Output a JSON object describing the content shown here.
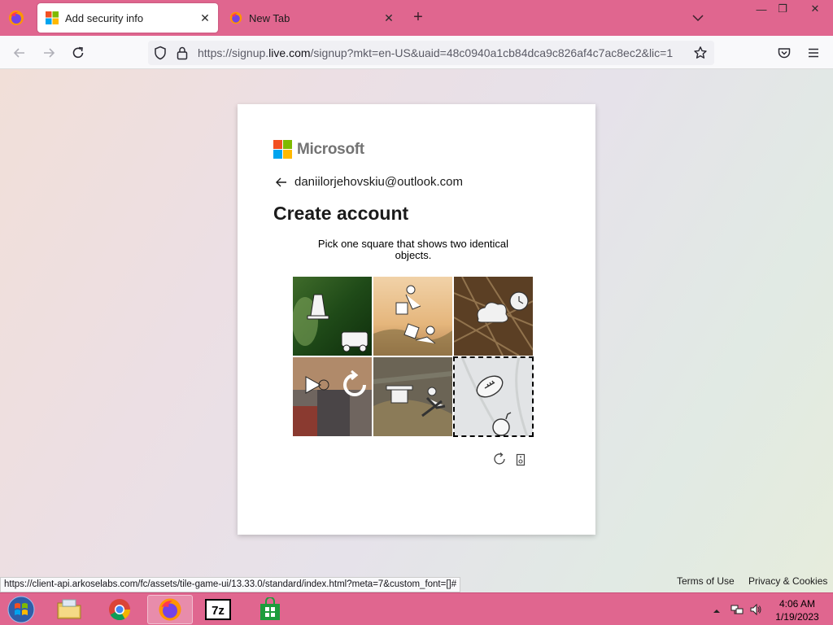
{
  "browser": {
    "tabs": [
      {
        "title": "Add security info",
        "active": true,
        "favicon": "microsoft-logo-icon"
      },
      {
        "title": "New Tab",
        "active": false,
        "favicon": "firefox-icon"
      }
    ],
    "new_tab_label": "+",
    "url_prefix": "https://signup.",
    "url_domain": "live.com",
    "url_rest": "/signup?mkt=en-US&uaid=48c0940a1cb84dca9c826af4c7ac8ec2&lic=1",
    "status_url": "https://client-api.arkoselabs.com/fc/assets/tile-game-ui/13.33.0/standard/index.html?meta=7&custom_font=[]#"
  },
  "signup": {
    "brand": "Microsoft",
    "email": "daniilorjehovskiu@outlook.com",
    "heading": "Create account",
    "instruction": "Pick one square that shows two identical objects.",
    "selected_tile": 6,
    "tiles": [
      {
        "name": "tile-1",
        "icons": [
          "bell-icon",
          "car-icon"
        ]
      },
      {
        "name": "tile-2",
        "icons": [
          "person-jumping-icon",
          "person-falling-icon"
        ]
      },
      {
        "name": "tile-3",
        "icons": [
          "cloud-icon",
          "alarm-clock-icon"
        ]
      },
      {
        "name": "tile-4",
        "icons": [
          "play-icon",
          "rotate-arrow-icon"
        ]
      },
      {
        "name": "tile-5",
        "icons": [
          "hat-icon",
          "skier-icon"
        ]
      },
      {
        "name": "tile-6",
        "icons": [
          "football-icon",
          "bomb-icon"
        ]
      }
    ]
  },
  "footer": {
    "terms": "Terms of Use",
    "privacy": "Privacy & Cookies"
  },
  "taskbar": {
    "apps": [
      "file-explorer-icon",
      "chrome-icon",
      "firefox-icon",
      "7zip-icon",
      "store-icon"
    ],
    "time": "4:06 AM",
    "date": "1/19/2023"
  },
  "colors": {
    "accent_pink": "#e0668f",
    "ms_red": "#f25022",
    "ms_green": "#7fba00",
    "ms_blue": "#00a4ef",
    "ms_yellow": "#ffb900"
  }
}
